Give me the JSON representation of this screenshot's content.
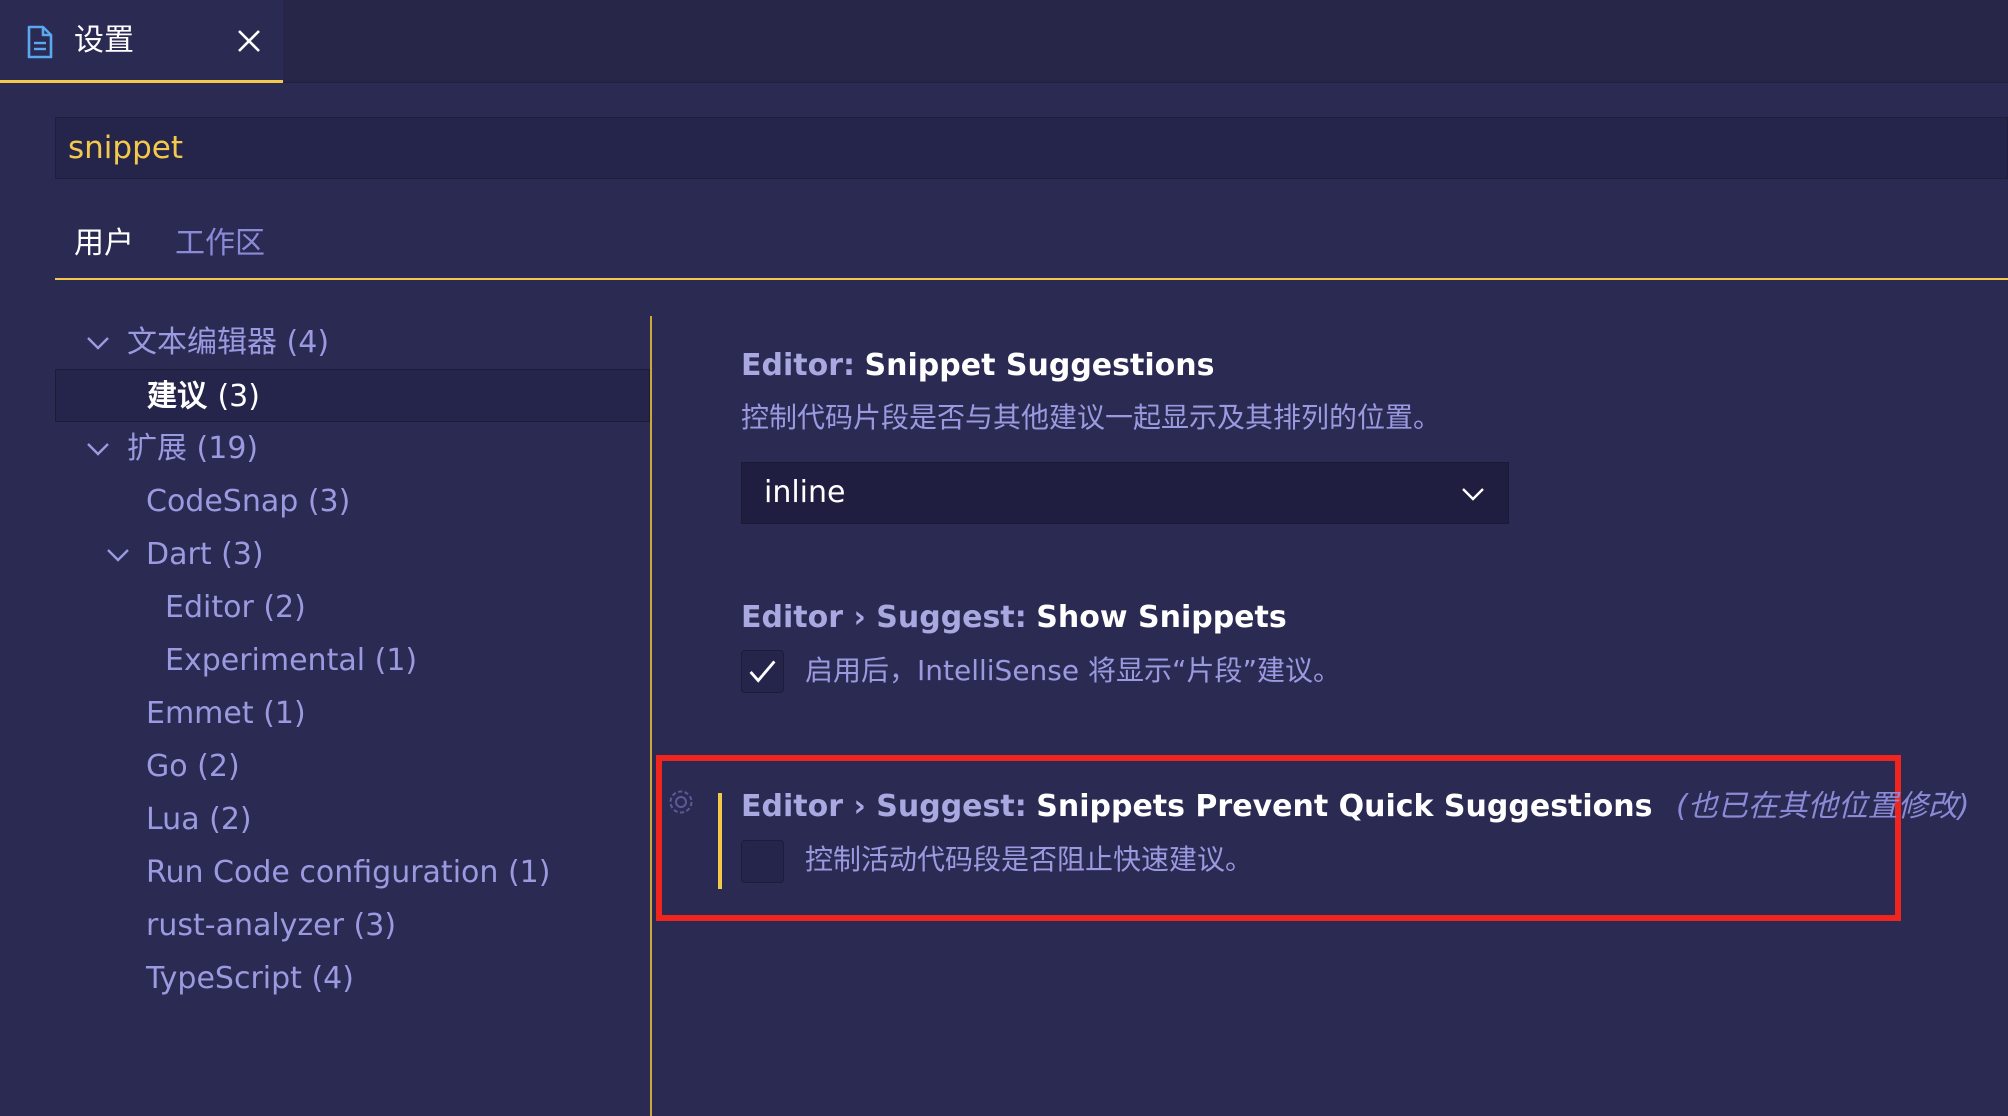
{
  "tab": {
    "title": "设置",
    "icon": "file-icon",
    "close_icon": "close-icon"
  },
  "search": {
    "value": "snippet"
  },
  "scope_tabs": {
    "user": "用户",
    "workspace": "工作区"
  },
  "tree": {
    "items": [
      {
        "label": "文本编辑器",
        "count": "(4)",
        "expanded": true
      },
      {
        "label": "建议",
        "count": "(3)",
        "selected": true
      },
      {
        "label": "扩展",
        "count": "(19)",
        "expanded": true
      },
      {
        "label": "CodeSnap",
        "count": "(3)"
      },
      {
        "label": "Dart",
        "count": "(3)",
        "expanded": true
      },
      {
        "label": "Editor",
        "count": "(2)"
      },
      {
        "label": "Experimental",
        "count": "(1)"
      },
      {
        "label": "Emmet",
        "count": "(1)"
      },
      {
        "label": "Go",
        "count": "(2)"
      },
      {
        "label": "Lua",
        "count": "(2)"
      },
      {
        "label": "Run Code configuration",
        "count": "(1)"
      },
      {
        "label": "rust-analyzer",
        "count": "(3)"
      },
      {
        "label": "TypeScript",
        "count": "(4)"
      }
    ]
  },
  "settings": {
    "snippet_suggestions": {
      "category": "Editor:",
      "name": "Snippet Suggestions",
      "description": "控制代码片段是否与其他建议一起显示及其排列的位置。",
      "value": "inline"
    },
    "show_snippets": {
      "category": "Editor › Suggest:",
      "name": "Show Snippets",
      "description": "启用后，IntelliSense 将显示“片段”建议。",
      "checked": true
    },
    "prevent_quick": {
      "category": "Editor › Suggest:",
      "name": "Snippets Prevent Quick Suggestions",
      "modified_note": "(也已在其他位置修改)",
      "description": "控制活动代码段是否阻止快速建议。",
      "checked": false
    }
  },
  "colors": {
    "accent": "#f2c94c",
    "highlight": "#f0251e",
    "background": "#2b2a52"
  }
}
